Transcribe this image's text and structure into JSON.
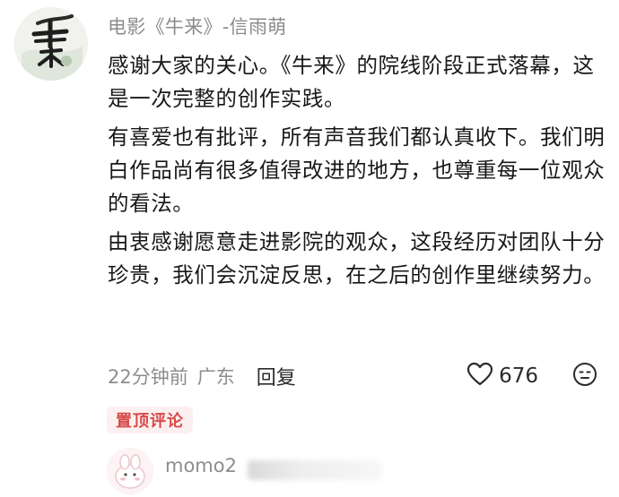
{
  "comment": {
    "author": "电影《牛来》-信雨萌",
    "paragraphs": [
      "感谢大家的关心。《牛来》的院线阶段正式落幕，这是一次完整的创作实践。",
      "有喜爱也有批评，所有声音我们都认真收下。我们明白作品尚有很多值得改进的地方，也尊重每一位观众的看法。",
      "由衷感谢愿意走进影院的观众，这段经历对团队十分珍贵，我们会沉淀反思，在之后的创作里继续努力。"
    ],
    "time": "22分钟前",
    "location": "广东",
    "reply_label": "回复",
    "like_count": "676",
    "pinned_label": "置顶评论"
  },
  "next_comment": {
    "author_partial": "momo2"
  },
  "icons": {
    "like": "heart-outline-icon",
    "reaction": "emoji-face-icon"
  },
  "colors": {
    "pinned_text": "#d64a4a",
    "pinned_bg": "#fcefef",
    "meta_gray": "#8d8d8d"
  }
}
